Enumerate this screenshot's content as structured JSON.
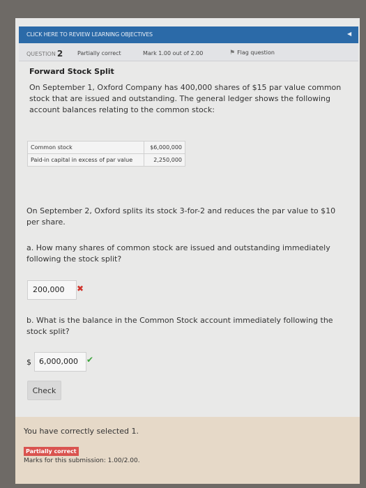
{
  "topbar": {
    "review_link": "CLICK HERE TO REVIEW LEARNING OBJECTIVES",
    "collapse_icon": "caret-left-icon"
  },
  "question_info": {
    "question_label": "QUESTION",
    "question_number": "2",
    "status": "Partially correct",
    "mark": "Mark 1.00 out of 2.00",
    "flag_label": "Flag question"
  },
  "question": {
    "title": "Forward Stock Split",
    "intro": "On September 1, Oxford Company has 400,000 shares of $15 par value common stock that are issued and outstanding. The general ledger shows the following account balances relating to the common stock:",
    "ledger": [
      {
        "account": "Common stock",
        "amount": "$6,000,000"
      },
      {
        "account": "Paid-in capital in excess of par value",
        "amount": "2,250,000"
      }
    ],
    "split_text": "On September 2, Oxford splits its stock 3-for-2 and reduces the par value to $10 per share.",
    "part_a": "a. How many shares of common stock are issued and outstanding immediately following the stock split?",
    "answer_a": "200,000",
    "part_b": "b. What is the balance in the Common Stock account immediately following the stock split?",
    "currency": "$",
    "answer_b": "6,000,000",
    "check_label": "Check"
  },
  "feedback": {
    "message": "You have correctly selected 1.",
    "badge": "Partially correct",
    "marks": "Marks for this submission: 1.00/2.00."
  },
  "colors": {
    "header_blue": "#2b6aa8",
    "incorrect": "#d0342c",
    "correct": "#3ca43c",
    "badge_red": "#d9534f",
    "feedback_bg": "#e6d9c8"
  }
}
